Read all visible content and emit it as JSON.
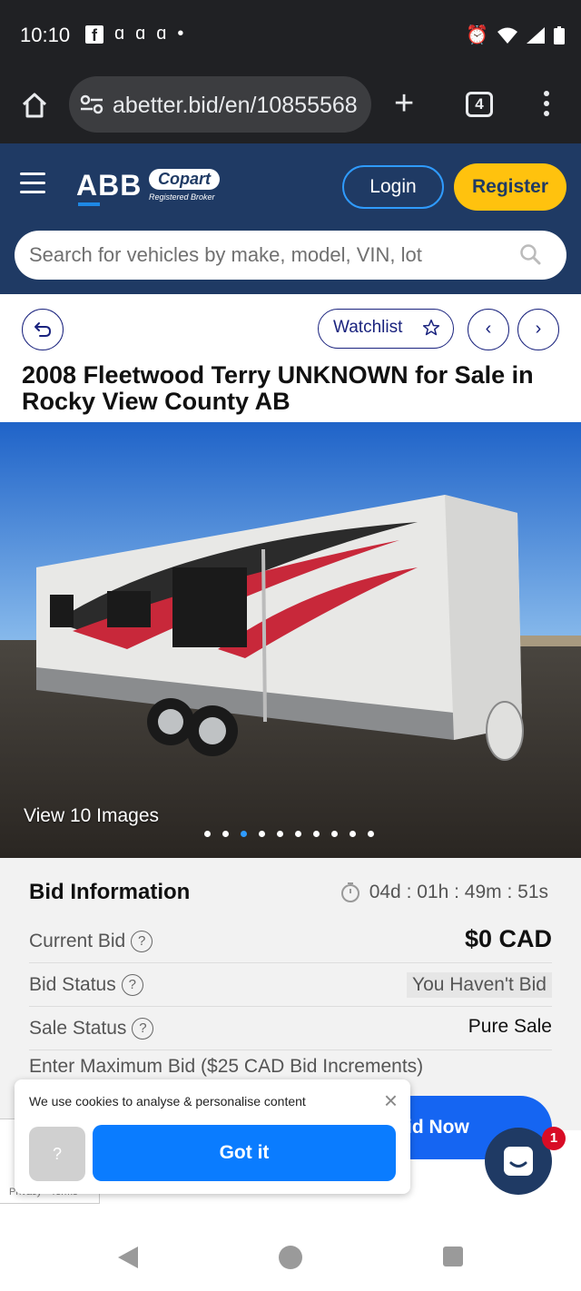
{
  "status_bar": {
    "time": "10:10",
    "notif_icons": [
      "facebook-icon",
      "messenger-icon",
      "messenger-icon",
      "messenger-icon"
    ]
  },
  "browser": {
    "url": "abetter.bid/en/10855568",
    "tab_count": "4"
  },
  "site_header": {
    "logo": "ABB",
    "partner_logo": "Copart",
    "partner_tagline": "Registered Broker",
    "login_label": "Login",
    "register_label": "Register",
    "search_placeholder": "Search for vehicles by make, model, VIN, lot"
  },
  "listing": {
    "watchlist_label": "Watchlist",
    "title": "2008 Fleetwood Terry UNKNOWN for Sale in Rocky View County AB",
    "view_images_label": "View 10 Images",
    "image_count": 10,
    "active_image_index": 2
  },
  "bid_info": {
    "heading": "Bid Information",
    "countdown": "04d : 01h : 49m : 51s",
    "rows": [
      {
        "label": "Current Bid",
        "value": "$0 CAD"
      },
      {
        "label": "Bid Status",
        "value": "You Haven't Bid"
      },
      {
        "label": "Sale Status",
        "value": "Pure Sale"
      }
    ],
    "enter_max_label": "Enter Maximum Bid ($25 CAD Bid Increments)",
    "bid_now_label": "id Now"
  },
  "cookie_banner": {
    "message": "We use cookies to analyse & personalise content",
    "help_label": "?",
    "got_it_label": "Got it"
  },
  "recaptcha": {
    "text": "Privacy - Terms"
  },
  "chat": {
    "badge_count": "1"
  },
  "colors": {
    "header_bg": "#1f3a64",
    "register_yellow": "#ffc20e",
    "primary_blue": "#0a7cff",
    "badge_red": "#d80c26"
  }
}
